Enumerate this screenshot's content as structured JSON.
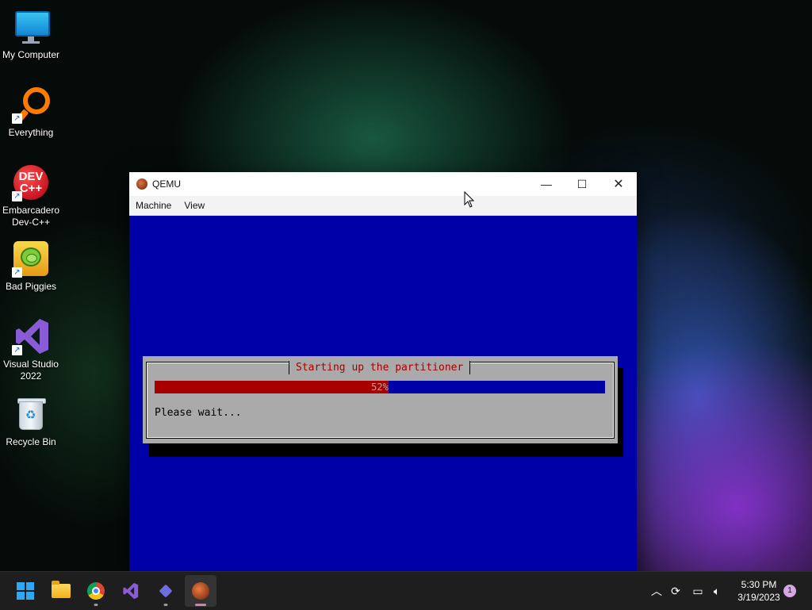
{
  "desktop": {
    "icons": [
      {
        "label_line1": "My Computer",
        "label_line2": ""
      },
      {
        "label_line1": "Everything",
        "label_line2": ""
      },
      {
        "label_line1": "Embarcadero",
        "label_line2": "Dev-C++"
      },
      {
        "label_line1": "Bad Piggies",
        "label_line2": ""
      },
      {
        "label_line1": "Visual Studio",
        "label_line2": "2022"
      },
      {
        "label_line1": "Recycle Bin",
        "label_line2": ""
      }
    ],
    "devcpp_badge_line1": "DEV",
    "devcpp_badge_line2": "C++"
  },
  "window": {
    "title": "QEMU",
    "menu": [
      "Machine",
      "View"
    ],
    "controls": {
      "minimize": "—",
      "maximize": "☐",
      "close": "✕"
    }
  },
  "installer": {
    "dialog_title": "Starting up the partitioner",
    "progress_percent": 52,
    "progress_label": "52%",
    "message": "Please wait..."
  },
  "taskbar": {
    "apps": [
      "start",
      "file-explorer",
      "chrome",
      "visual-studio",
      "app",
      "qemu"
    ],
    "tray": {
      "time": "5:30 PM",
      "date": "3/19/2023",
      "notification_count": "1"
    }
  },
  "colors": {
    "vm_background": "#0000a8",
    "dialog_background": "#aaaaaa",
    "progress_fill": "#a80000",
    "dialog_title": "#a80000"
  }
}
